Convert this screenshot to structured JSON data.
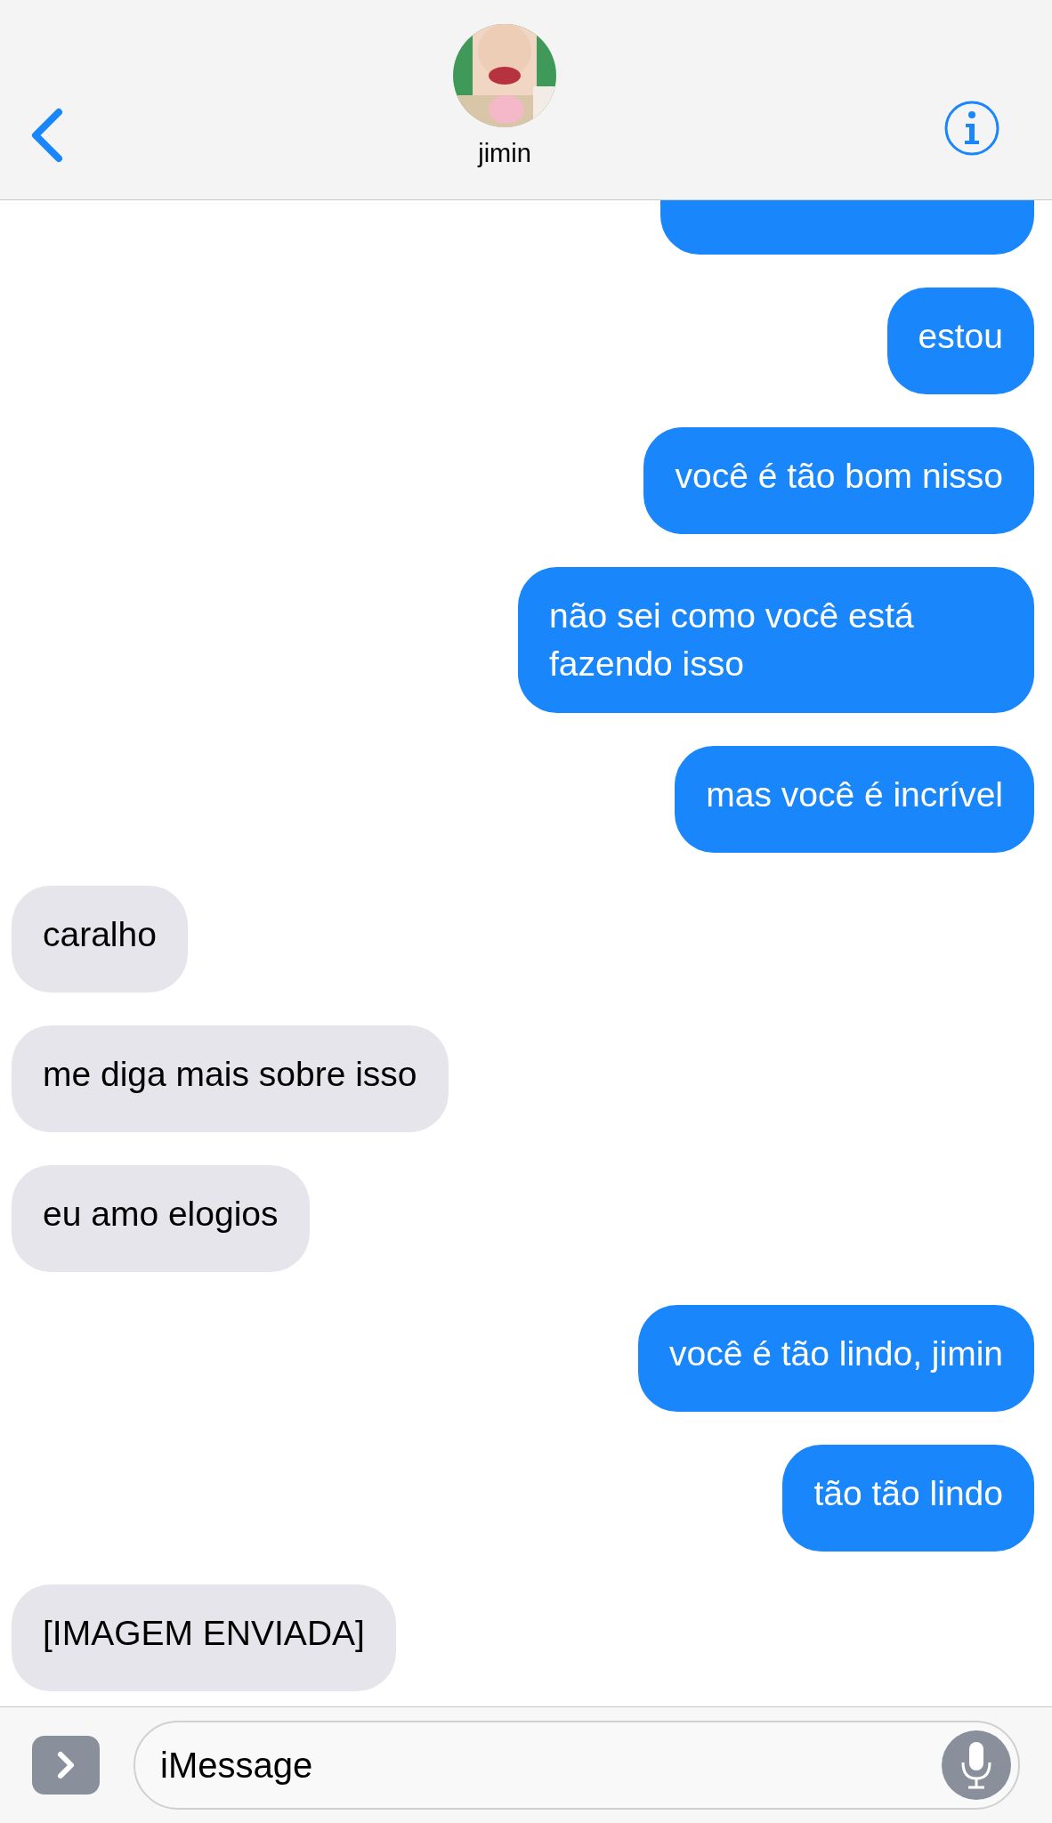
{
  "header": {
    "contact_name": "jimin"
  },
  "messages": [
    {
      "kind": "sent"
    },
    {
      "kind": "sent",
      "text": "estou"
    },
    {
      "kind": "sent",
      "text": "você é tão bom nisso"
    },
    {
      "kind": "sent",
      "text": "não sei como você está fazendo isso"
    },
    {
      "kind": "sent",
      "text": "mas você é incrível"
    },
    {
      "kind": "received",
      "text": "caralho"
    },
    {
      "kind": "received",
      "text": "me diga mais sobre isso"
    },
    {
      "kind": "received",
      "text": "eu amo elogios"
    },
    {
      "kind": "sent",
      "text": "você é tão lindo, jimin"
    },
    {
      "kind": "sent",
      "text": "tão tão lindo"
    },
    {
      "kind": "received",
      "text": "[IMAGEM ENVIADA]"
    }
  ],
  "composer": {
    "placeholder": "iMessage"
  }
}
